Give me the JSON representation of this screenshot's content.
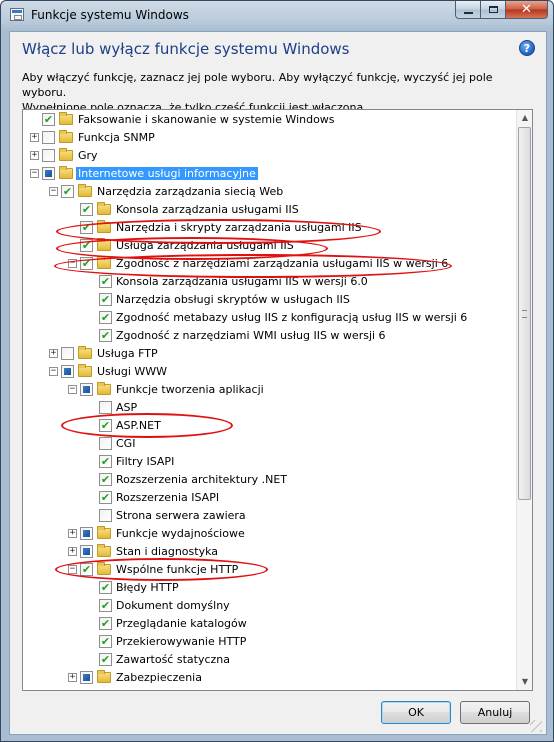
{
  "window": {
    "title": "Funkcje systemu Windows",
    "icon": "windows-features-icon",
    "controls": {
      "minimize": "minimize-icon",
      "maximize": "maximize-icon",
      "close": "close-icon"
    }
  },
  "header": {
    "heading": "Włącz lub wyłącz funkcje systemu Windows",
    "help_icon": "help-icon",
    "help_glyph": "?",
    "description_line1": "Aby włączyć funkcję, zaznacz jej pole wyboru. Aby wyłączyć funkcję, wyczyść jej pole wyboru.",
    "description_line2": "Wypełnione pole oznacza, że tylko część funkcji jest włączona."
  },
  "tree": [
    {
      "label": "Faksowanie i skanowanie w systemie Windows",
      "level": 0,
      "expander": "",
      "state": "checked"
    },
    {
      "label": "Funkcja SNMP",
      "level": 0,
      "expander": "+",
      "state": "unchecked"
    },
    {
      "label": "Gry",
      "level": 0,
      "expander": "+",
      "state": "unchecked"
    },
    {
      "label": "Internetowe usługi informacyjne",
      "level": 0,
      "expander": "-",
      "state": "partial",
      "selected": true
    },
    {
      "label": "Narzędzia zarządzania siecią Web",
      "level": 1,
      "expander": "-",
      "state": "checked"
    },
    {
      "label": "Konsola zarządzania usługami IIS",
      "level": 2,
      "expander": "",
      "state": "checked"
    },
    {
      "label": "Narzędzia i skrypty zarządzania usługami IIS",
      "level": 2,
      "expander": "",
      "state": "checked"
    },
    {
      "label": "Usługa zarządzania usługami IIS",
      "level": 2,
      "expander": "",
      "state": "checked"
    },
    {
      "label": "Zgodność z narzędziami zarządzania usługami IIS w wersji 6",
      "level": 2,
      "expander": "-",
      "state": "checked"
    },
    {
      "label": "Konsola zarządzania usługami IIS w wersji 6.0",
      "level": 3,
      "expander": "",
      "state": "checked",
      "noicon": true
    },
    {
      "label": "Narzędzia obsługi skryptów w usługach IIS",
      "level": 3,
      "expander": "",
      "state": "checked",
      "noicon": true
    },
    {
      "label": "Zgodność metabazy usług IIS z konfiguracją usług IIS w wersji 6",
      "level": 3,
      "expander": "",
      "state": "checked",
      "noicon": true
    },
    {
      "label": "Zgodność z narzędziami WMI usług IIS w wersji 6",
      "level": 3,
      "expander": "",
      "state": "checked",
      "noicon": true
    },
    {
      "label": "Usługa FTP",
      "level": 1,
      "expander": "+",
      "state": "unchecked"
    },
    {
      "label": "Usługi WWW",
      "level": 1,
      "expander": "-",
      "state": "partial"
    },
    {
      "label": "Funkcje tworzenia aplikacji",
      "level": 2,
      "expander": "-",
      "state": "partial"
    },
    {
      "label": "ASP",
      "level": 3,
      "expander": "",
      "state": "unchecked",
      "noicon": true
    },
    {
      "label": "ASP.NET",
      "level": 3,
      "expander": "",
      "state": "checked",
      "noicon": true
    },
    {
      "label": "CGI",
      "level": 3,
      "expander": "",
      "state": "unchecked",
      "noicon": true
    },
    {
      "label": "Filtry ISAPI",
      "level": 3,
      "expander": "",
      "state": "checked",
      "noicon": true
    },
    {
      "label": "Rozszerzenia architektury .NET",
      "level": 3,
      "expander": "",
      "state": "checked",
      "noicon": true
    },
    {
      "label": "Rozszerzenia ISAPI",
      "level": 3,
      "expander": "",
      "state": "checked",
      "noicon": true
    },
    {
      "label": "Strona serwera zawiera",
      "level": 3,
      "expander": "",
      "state": "unchecked",
      "noicon": true
    },
    {
      "label": "Funkcje wydajnościowe",
      "level": 2,
      "expander": "+",
      "state": "partial"
    },
    {
      "label": "Stan i diagnostyka",
      "level": 2,
      "expander": "+",
      "state": "partial"
    },
    {
      "label": "Wspólne funkcje HTTP",
      "level": 2,
      "expander": "-",
      "state": "checked"
    },
    {
      "label": "Błędy HTTP",
      "level": 3,
      "expander": "",
      "state": "checked",
      "noicon": true
    },
    {
      "label": "Dokument domyślny",
      "level": 3,
      "expander": "",
      "state": "checked",
      "noicon": true
    },
    {
      "label": "Przeglądanie katalogów",
      "level": 3,
      "expander": "",
      "state": "checked",
      "noicon": true
    },
    {
      "label": "Przekierowywanie HTTP",
      "level": 3,
      "expander": "",
      "state": "checked",
      "noicon": true
    },
    {
      "label": "Zawartość statyczna",
      "level": 3,
      "expander": "",
      "state": "checked",
      "noicon": true
    },
    {
      "label": "Zabezpieczenia",
      "level": 2,
      "expander": "+",
      "state": "partial"
    }
  ],
  "scrollbar": {
    "up_icon": "scroll-up-arrow-icon",
    "down_icon": "scroll-down-arrow-icon",
    "up_glyph": "▲",
    "down_glyph": "▼"
  },
  "buttons": {
    "ok": "OK",
    "cancel": "Anuluj"
  },
  "colors": {
    "heading": "#1d3f87",
    "selection": "#3399ff",
    "annotation": "#e01010"
  }
}
